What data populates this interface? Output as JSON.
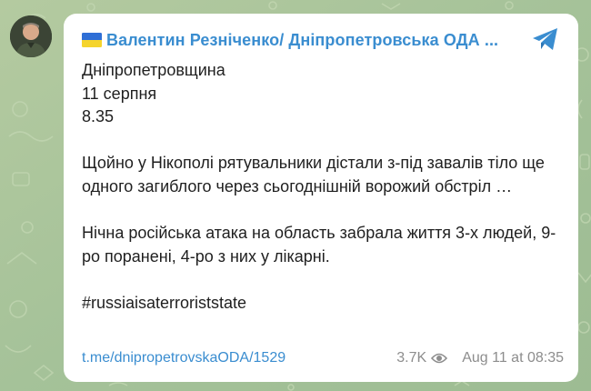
{
  "channel": {
    "name": "Валентин Резніченко/ Дніпропетровська ОДА ..."
  },
  "message": {
    "line1": "Дніпропетровщина",
    "line2": "11 серпня",
    "line3": "8.35",
    "para2": "Щойно у Нікополі рятувальники дістали з-під завалів тіло ще одного загиблого через сьогоднішній ворожий обстріл …",
    "para3": "Нічна російська атака на область забрала життя 3-х людей, 9-ро поранені, 4-ро з них у лікарні.",
    "hashtag": "#russiaisaterroriststate"
  },
  "footer": {
    "link": "t.me/dnipropetrovskaODA/1529",
    "views": "3.7K",
    "date": "Aug 11 at 08:35"
  },
  "colors": {
    "accent": "#3a8dd0",
    "background": "#a9c49a",
    "meta_text": "#8d8d8d"
  },
  "icons": {
    "flag": "ukraine-flag-icon",
    "share": "telegram-share-icon",
    "views": "eye-icon"
  }
}
